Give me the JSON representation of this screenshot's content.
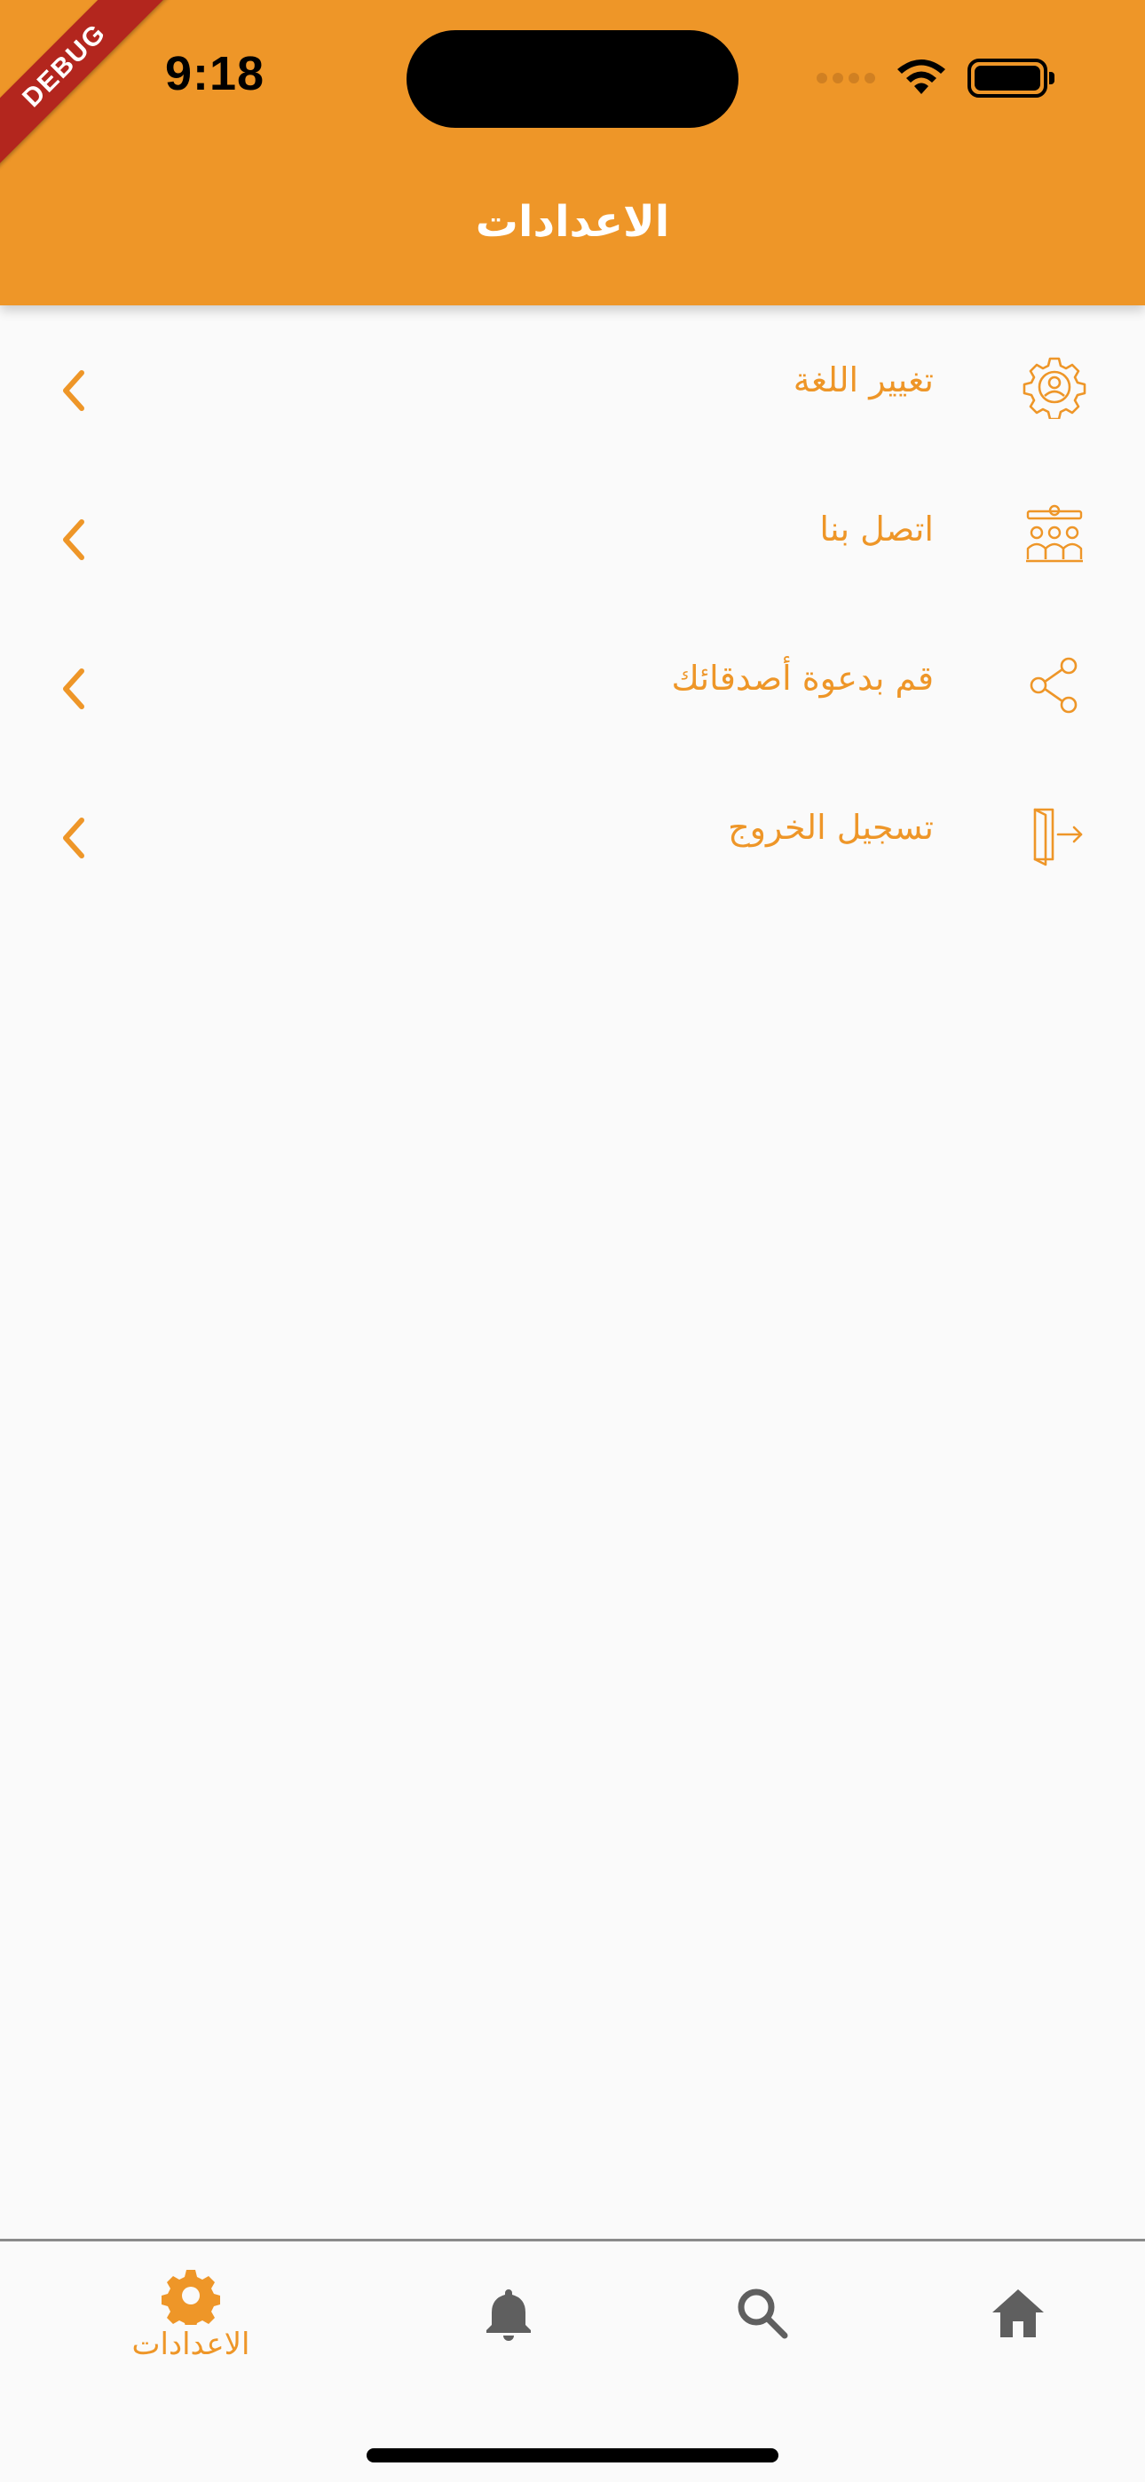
{
  "status_bar": {
    "time": "9:18"
  },
  "debug_banner": "DEBUG",
  "app_bar": {
    "title": "الاعدادات"
  },
  "settings": {
    "items": [
      {
        "label": "تغيير اللغة",
        "icon": "settings-gear-user-icon"
      },
      {
        "label": "اتصل بنا",
        "icon": "team-contact-icon"
      },
      {
        "label": "قم بدعوة أصدقائك",
        "icon": "share-icon"
      },
      {
        "label": "تسجيل الخروج",
        "icon": "logout-icon"
      }
    ]
  },
  "bottom_nav": {
    "items": [
      {
        "icon": "gear-icon",
        "label": "الاعدادات",
        "active": true
      },
      {
        "icon": "bell-icon",
        "active": false
      },
      {
        "icon": "search-icon",
        "active": false
      },
      {
        "icon": "home-icon",
        "active": false
      }
    ]
  },
  "colors": {
    "accent": "#ee9628",
    "inactive_icon": "#5f5f5f",
    "background": "#fafafa"
  }
}
